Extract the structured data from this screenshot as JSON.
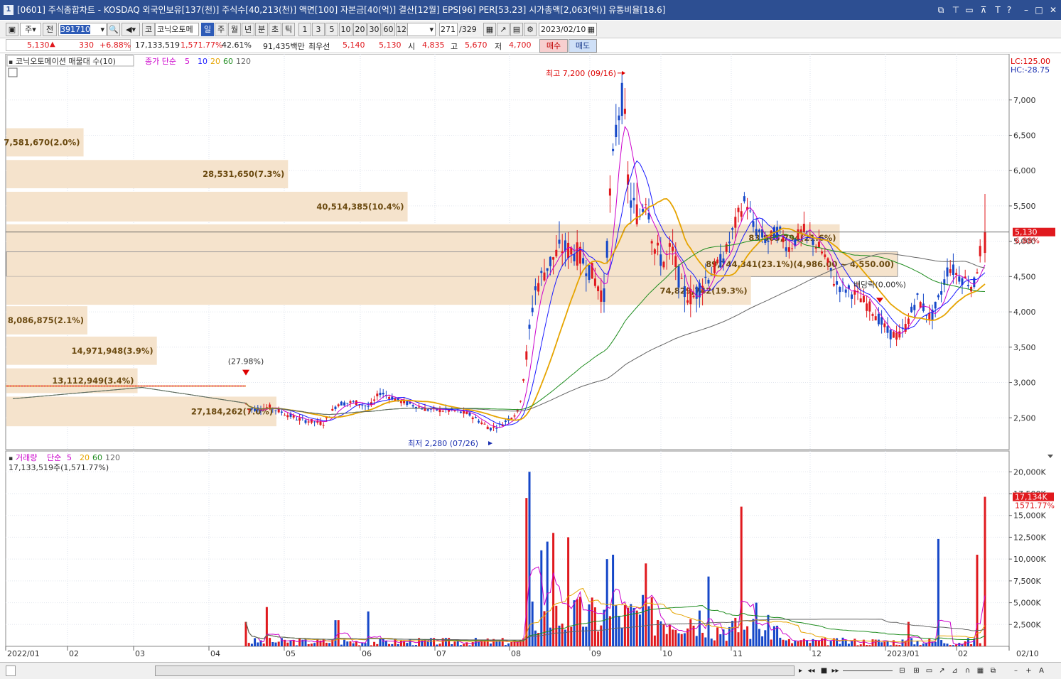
{
  "window": {
    "title": "[0601] 주식종합차트 - KOSDAQ 외국인보유[137(천)] 주식수[40,213(천)] 액면[100] 자본금[40(억)] 결산[12월] EPS[96] PER[53.23] 시가총액[2,063(억)] 유통비율[18.6]",
    "number": "1"
  },
  "toolbar": {
    "period_type": "주",
    "prev_label": "전",
    "code": "391710",
    "stock_name": "코닉오토메",
    "stock_prefix": "코",
    "periods": [
      "일",
      "주",
      "월",
      "년",
      "분",
      "초",
      "틱"
    ],
    "period_selected": "일",
    "intervals": [
      "1",
      "3",
      "5",
      "10",
      "20",
      "30",
      "60",
      "120"
    ],
    "count": "271",
    "total": "/329",
    "date": "2023/02/10"
  },
  "quote": {
    "price": "5,130",
    "change": "330",
    "change_pct": "+6.88%",
    "volume": "17,133,519",
    "volume_pct": "1,571.77%",
    "turnover_pct": "42.61%",
    "amount": "91,435백만",
    "best_ask_label": "최우선",
    "ask": "5,140",
    "bid": "5,130",
    "open_label": "시",
    "open": "4,835",
    "high_label": "고",
    "high": "5,670",
    "low_label": "저",
    "low": "4,700",
    "buy_label": "매수",
    "sell_label": "매도"
  },
  "chart_data": {
    "type": "candlestick",
    "title": "코닉오토메이션 매물대 수(10)",
    "ma_legend": {
      "prefix": "종가 단순",
      "periods": [
        "5",
        "10",
        "20",
        "60",
        "120"
      ],
      "colors": [
        "#cc00cc",
        "#1a1aff",
        "#e6a400",
        "#1e8c1e",
        "#666666"
      ]
    },
    "price_axis": {
      "ticks": [
        "7,000",
        "6,500",
        "6,000",
        "5,500",
        "5,000",
        "4,500",
        "4,000",
        "3,500",
        "3,000",
        "2,500"
      ],
      "min": 2050,
      "max": 7450
    },
    "lc_label": "LC:125.00",
    "hc_label": "HC:-28.75",
    "current_price_label": "5,130",
    "current_pct_label": "6.88%",
    "current_price": 5130,
    "high_annotation": {
      "text": "최고 7,200 (09/16)",
      "value": 7200
    },
    "low_annotation": {
      "text": "최저 2,280 (07/26)",
      "value": 2280
    },
    "gap_annotation": "(27.98%)",
    "dividend_annotation": "배당락(0.00%)",
    "x_axis": [
      "2022/01",
      "02",
      "03",
      "04",
      "05",
      "06",
      "07",
      "08",
      "09",
      "10",
      "11",
      "12",
      "2023/01",
      "02",
      "02/10"
    ],
    "volume_profile": [
      {
        "label": "7,581,670(2.0%)",
        "from": 6600,
        "to": 6200,
        "pct": 2.0
      },
      {
        "label": "28,531,650(7.3%)",
        "from": 6150,
        "to": 5750,
        "pct": 7.3
      },
      {
        "label": "40,514,385(10.4%)",
        "from": 5700,
        "to": 5280,
        "pct": 10.4
      },
      {
        "label": "83,865,794(21.6%)",
        "from": 5240,
        "to": 4850,
        "pct": 21.6
      },
      {
        "label": "89,744,341(23.1%)(4,986.00 ~ 4,550.00)",
        "from": 4850,
        "to": 4500,
        "pct": 23.1
      },
      {
        "label": "74,829,742(19.3%)",
        "from": 4500,
        "to": 4100,
        "pct": 19.3
      },
      {
        "label": "8,086,875(2.1%)",
        "from": 4080,
        "to": 3680,
        "pct": 2.1
      },
      {
        "label": "14,971,948(3.9%)",
        "from": 3650,
        "to": 3250,
        "pct": 3.9
      },
      {
        "label": "13,112,949(3.4%)",
        "from": 3200,
        "to": 2850,
        "pct": 3.4
      },
      {
        "label": "27,184,262(7.0%)",
        "from": 2800,
        "to": 2380,
        "pct": 7.0
      }
    ],
    "volume_panel": {
      "title": "거래량",
      "ma_prefix": "단순",
      "ma_periods": [
        "5",
        "20",
        "60",
        "120"
      ],
      "ma_colors": [
        "#cc00cc",
        "#e6a400",
        "#1e8c1e",
        "#666666"
      ],
      "info": "17,133,519주(1,571.77%)",
      "ticks": [
        "20,000K",
        "17,500K",
        "15,000K",
        "12,500K",
        "10,000K",
        "7,500K",
        "5,000K",
        "2,500K"
      ],
      "max": 21000,
      "current_label": "17,134K",
      "current_pct_label": "1571.77%",
      "current_value": 17134
    }
  },
  "colors": {
    "up": "#e0191e",
    "down": "#1547c8",
    "profile": "#f5e3cc",
    "profile_text": "#6b4a10",
    "titlebar": "#2d4f92"
  }
}
